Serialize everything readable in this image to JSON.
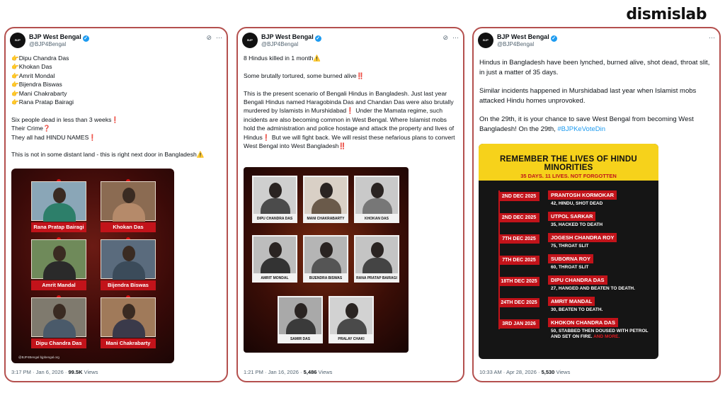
{
  "brand": "dismislab",
  "tweets": [
    {
      "display_name": "BJP West Bengal",
      "handle": "@BJP4Bengal",
      "avatar_text": "BJP",
      "text": "👉Dipu Chandra Das\n👉Khokan Das\n👉Amrit Mondal\n👉Bijendra Biswas\n👉Mani Chakrabarty\n👉Rana Pratap Bairagi\n\nSix people dead in less than 3 weeks❗\nTheir Crime❓\nThey all had HINDU NAMES❗\n\nThis is not in some distant land - this is right next door in Bangladesh⚠️",
      "poster": {
        "labels": [
          "Rana Pratap Bairagi",
          "Khokan Das",
          "Amrit Mandal",
          "Bijendra Biswas",
          "Dipu Chandra Das",
          "Mani Chakrabarty"
        ],
        "footer": "@BJP4Bengal   bjpbengal.org"
      },
      "time": "3:17 PM · Jan 6, 2026 ·",
      "views_count": "99.5K",
      "views_label": "Views"
    },
    {
      "display_name": "BJP West Bengal",
      "handle": "@BJP4Bengal",
      "avatar_text": "BJP",
      "text": "8 Hindus killed in 1 month⚠️\n\nSome brutally tortured, some burned alive‼️\n\nThis is the present scenario of Bengali Hindus in Bangladesh. Just last year Bengali Hindus named Haragobinda Das and Chandan Das were also brutally murdered by Islamists in Murshidabad❗ Under the Mamata regime, such incidents are also becoming common in West Bengal. Where Islamist mobs hold the administration and police hostage and attack the property and lives of Hindus❗ But we will fight back. We will resist these nefarious plans to convert West Bengal into West Bangladesh‼️",
      "poster": {
        "labels": [
          "DIPU CHANDRA DAS",
          "MANI CHAKRABARTY",
          "KHOKAN DAS",
          "AMRIT MONDAL",
          "BIJENDRA BISWAS",
          "RANA PRATAP BAIRAGI",
          "SAMIR DAS",
          "PRALAY CHAKI"
        ]
      },
      "time": "1:21 PM · Jan 16, 2026 ·",
      "views_count": "5,486",
      "views_label": "Views"
    },
    {
      "display_name": "BJP West Bengal",
      "handle": "@BJP4Bengal",
      "avatar_text": "BJP",
      "text_p1": "Hindus in Bangladesh have been lynched, burned alive, shot dead, throat slit, in just a matter of 35 days.",
      "text_p2": "Similar incidents happened in Murshidabad last year when Islamist mobs attacked Hindu homes unprovoked.",
      "text_p3": "On the 29th, it is your chance to save West Bengal from becoming West Bangladesh! On the 29th, ",
      "hashtag": "#BJPKeVoteDin",
      "poster": {
        "title": "REMEMBER THE LIVES OF HINDU MINORITIES",
        "subtitle": "35 DAYS. 11 LIVES. NOT FORGOTTEN",
        "entries": [
          {
            "date": "2ND DEC 2025",
            "name": "PRANTOSH KORMOKAR",
            "desc": "42, HINDU, SHOT DEAD"
          },
          {
            "date": "2ND DEC 2025",
            "name": "UTPOL SARKAR",
            "desc": "35, HACKED TO DEATH"
          },
          {
            "date": "7TH DEC 2025",
            "name": "JOGESH CHANDRA ROY",
            "desc": "75, THROAT SLIT"
          },
          {
            "date": "7TH DEC 2025",
            "name": "SUBORNA ROY",
            "desc": "60, THROAT SLIT"
          },
          {
            "date": "18TH DEC 2025",
            "name": "DIPU CHANDRA DAS",
            "desc": "27, HANGED AND BEATEN TO DEATH."
          },
          {
            "date": "24TH DEC 2025",
            "name": "AMRIT MANDAL",
            "desc": "30, BEATEN TO DEATH."
          },
          {
            "date": "3RD JAN 2026",
            "name": "KHOKON CHANDRA DAS",
            "desc": "50, STABBED THEN DOUSED WITH PETROL AND SET ON FIRE.",
            "more": "AND MORE."
          }
        ]
      },
      "time": "10:33 AM · Apr 28, 2026 ·",
      "views_count": "5,530",
      "views_label": "Views"
    }
  ],
  "colors": {
    "card_border": "#b4504e",
    "accent_red": "#c2131a",
    "banner_yellow": "#f6d21b",
    "link_blue": "#1d9bf0"
  }
}
